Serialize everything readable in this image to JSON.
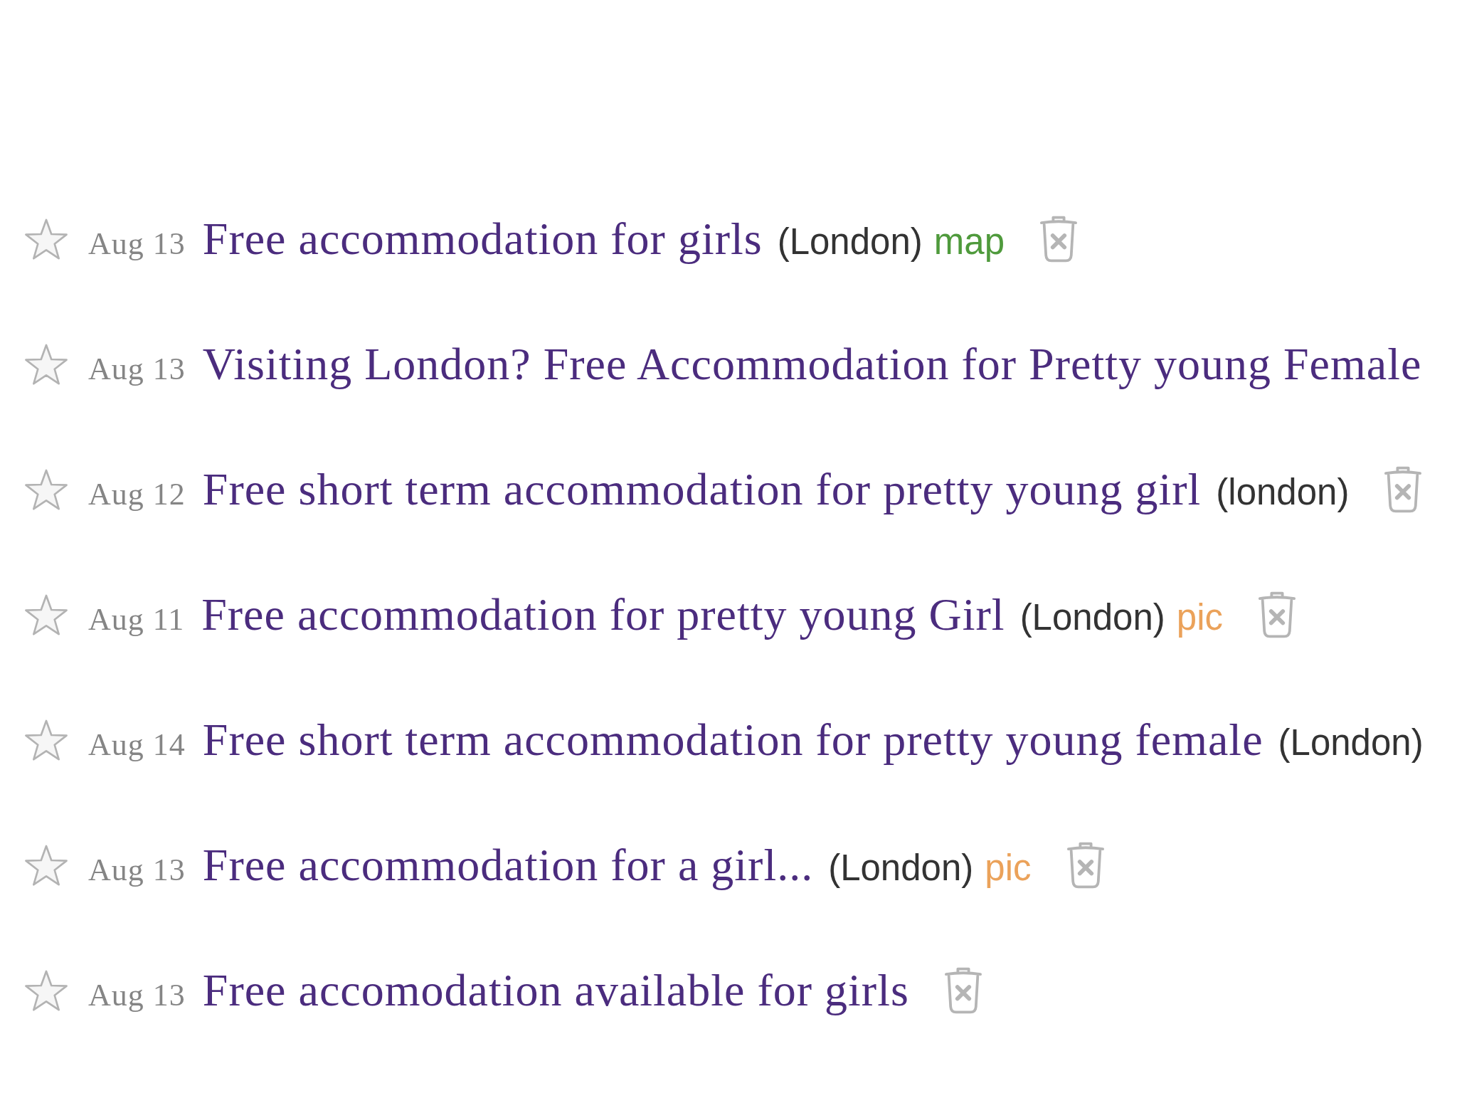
{
  "listings": [
    {
      "starred": false,
      "date": "Aug 13",
      "title": "Free accommodation for girls",
      "location": "(London)",
      "tags": [
        {
          "kind": "map",
          "label": "map"
        }
      ],
      "hide_icon": true
    },
    {
      "starred": false,
      "date": "Aug 13",
      "title": "Visiting London? Free Accommodation for Pretty young Female"
    },
    {
      "starred": false,
      "date": "Aug 12",
      "title": "Free short term accommodation for pretty young girl",
      "location": "(london)",
      "hide_icon": true
    },
    {
      "starred": false,
      "date": "Aug 11",
      "title": "Free accommodation for pretty young Girl",
      "location": "(London)",
      "tags": [
        {
          "kind": "pic",
          "label": "pic"
        }
      ],
      "hide_icon": true
    },
    {
      "starred": false,
      "date": "Aug 14",
      "title": "Free short term accommodation for pretty young female",
      "location": "(London)"
    },
    {
      "starred": false,
      "date": "Aug 13",
      "title": "Free accommodation for a girl...",
      "location": "(London)",
      "tags": [
        {
          "kind": "pic",
          "label": "pic"
        }
      ],
      "hide_icon": true
    },
    {
      "starred": false,
      "date": "Aug 13",
      "title": "Free accomodation available for girls",
      "hide_icon": true
    }
  ]
}
